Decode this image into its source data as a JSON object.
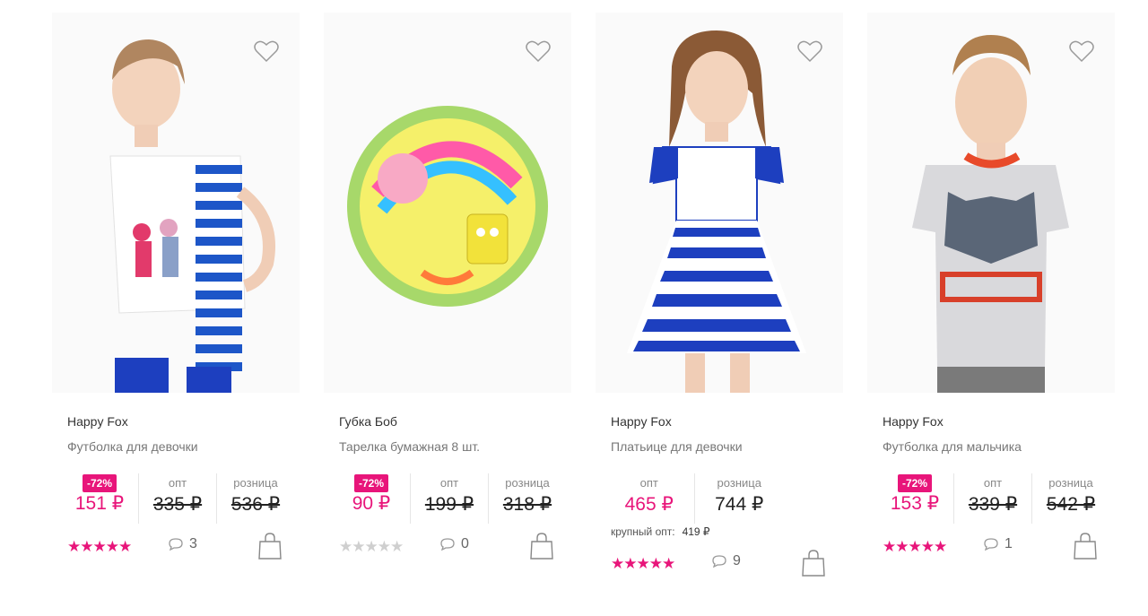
{
  "colors": {
    "accent": "#e8157a",
    "star_off": "#cfcfcf"
  },
  "labels": {
    "opt": "опт",
    "retail": "розница",
    "bulk": "крупный опт:"
  },
  "products": [
    {
      "brand": "Happy Fox",
      "title": "Футболка для девочки",
      "discount": "-72%",
      "sale_price": "151 ₽",
      "opt_price": "335 ₽",
      "retail_price": "536 ₽",
      "rating": 5,
      "reviews": "3",
      "icon": "heart-icon"
    },
    {
      "brand": "Губка Боб",
      "title": "Тарелка бумажная 8 шт.",
      "discount": "-72%",
      "sale_price": "90 ₽",
      "opt_price": "199 ₽",
      "retail_price": "318 ₽",
      "rating": 0,
      "reviews": "0",
      "icon": "heart-icon"
    },
    {
      "brand": "Happy Fox",
      "title": "Платьице для девочки",
      "opt_price": "465 ₽",
      "retail_price": "744 ₽",
      "bulk_price": "419 ₽",
      "rating": 5,
      "reviews": "9",
      "icon": "heart-icon"
    },
    {
      "brand": "Happy Fox",
      "title": "Футболка для мальчика",
      "discount": "-72%",
      "sale_price": "153 ₽",
      "opt_price": "339 ₽",
      "retail_price": "542 ₽",
      "rating": 5,
      "reviews": "1",
      "icon": "heart-icon"
    }
  ]
}
